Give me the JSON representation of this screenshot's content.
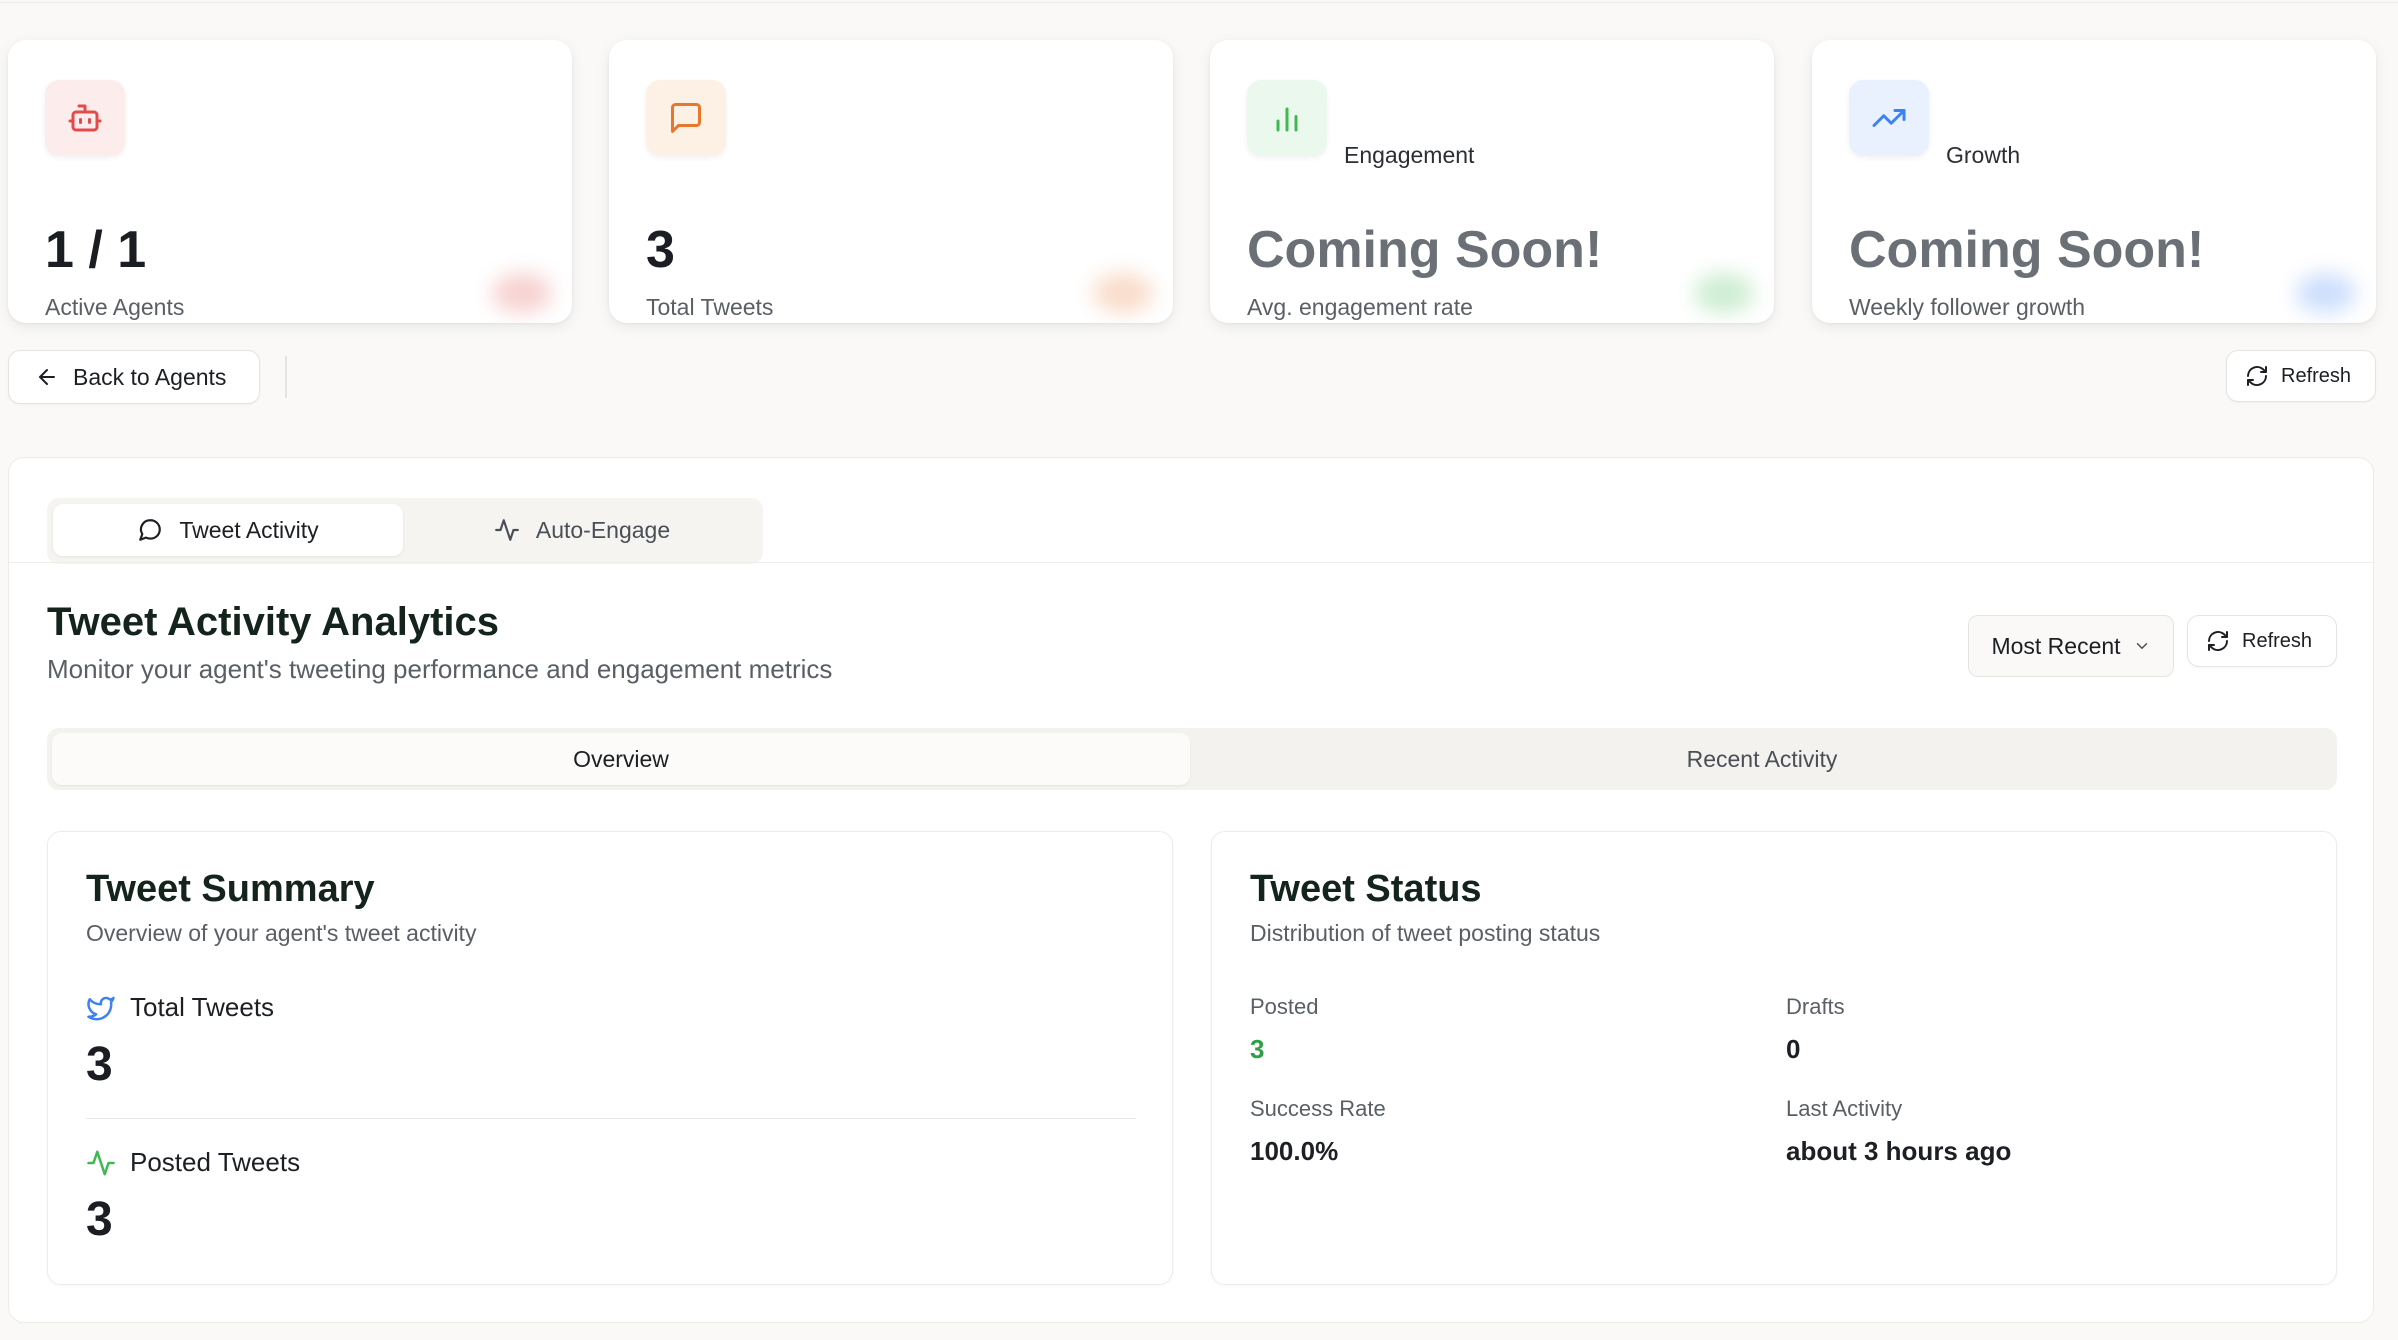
{
  "stats": [
    {
      "icon": "bot-icon",
      "label": "",
      "value": "1 / 1",
      "sub": "Active Agents",
      "accent": "#e24b4b",
      "bg": "#fdecec"
    },
    {
      "icon": "message-square-icon",
      "label": "",
      "value": "3",
      "sub": "Total Tweets",
      "accent": "#e8772e",
      "bg": "#fdf1e6"
    },
    {
      "icon": "bar-chart-icon",
      "label": "Engagement",
      "value": "Coming Soon!",
      "sub": "Avg. engagement rate",
      "accent": "#3fb950",
      "bg": "#eaf8ee"
    },
    {
      "icon": "trending-up-icon",
      "label": "Growth",
      "value": "Coming Soon!",
      "sub": "Weekly follower growth",
      "accent": "#3b82f6",
      "bg": "#eaf1fe"
    }
  ],
  "toolbar": {
    "back_label": "Back to Agents",
    "refresh_label": "Refresh"
  },
  "tabs": [
    {
      "label": "Tweet Activity",
      "icon": "message-circle-icon",
      "active": true
    },
    {
      "label": "Auto-Engage",
      "icon": "activity-icon",
      "active": false
    }
  ],
  "section": {
    "title": "Tweet Activity Analytics",
    "subtitle": "Monitor your agent's tweeting performance and engagement metrics",
    "sort_selected": "Most Recent",
    "refresh_label": "Refresh"
  },
  "subtabs": [
    {
      "label": "Overview",
      "active": true
    },
    {
      "label": "Recent Activity",
      "active": false
    }
  ],
  "summary": {
    "title": "Tweet Summary",
    "subtitle": "Overview of your agent's tweet activity",
    "total_label": "Total Tweets",
    "total_value": "3",
    "posted_label": "Posted Tweets",
    "posted_value": "3"
  },
  "status": {
    "title": "Tweet Status",
    "subtitle": "Distribution of tweet posting status",
    "posted_label": "Posted",
    "posted_value": "3",
    "drafts_label": "Drafts",
    "drafts_value": "0",
    "success_label": "Success Rate",
    "success_value": "100.0%",
    "last_label": "Last Activity",
    "last_value": "about 3 hours ago"
  },
  "colors": {
    "success_green": "#2ea043",
    "twitter_blue": "#3b82f6",
    "activity_green": "#3fb950"
  }
}
